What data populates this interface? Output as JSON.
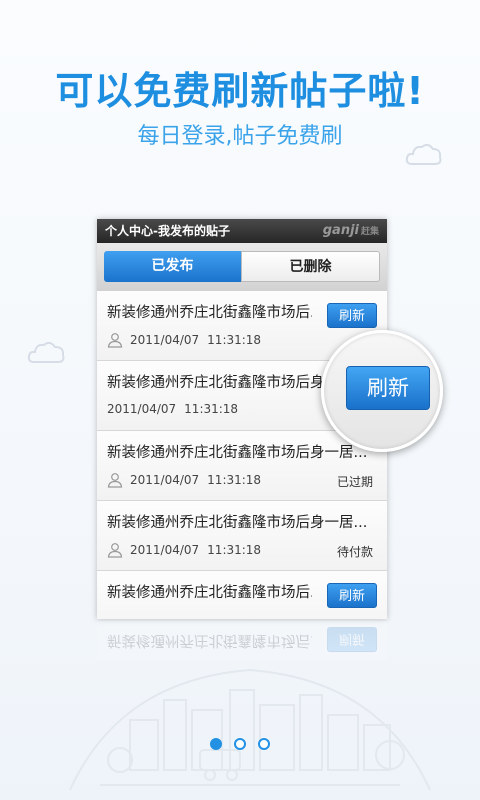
{
  "promo": {
    "headline": "可以免费刷新帖子啦!",
    "subline": "每日登录,帖子免费刷"
  },
  "screen": {
    "title": "个人中心-我发布的贴子",
    "brand": "ganji",
    "brand_sub": "赶集",
    "tabs": [
      {
        "label": "已发布",
        "active": true
      },
      {
        "label": "已删除",
        "active": false
      }
    ],
    "posts": [
      {
        "title": "新装修通州乔庄北街鑫隆市场后...",
        "date": "2011/04/07",
        "time": "11:31:18",
        "action": "刷新",
        "status": ""
      },
      {
        "title": "新装修通州乔庄北街鑫隆市场后身",
        "date": "2011/04/07",
        "time": "11:31:18",
        "action": "",
        "status": ""
      },
      {
        "title": "新装修通州乔庄北街鑫隆市场后身一居...",
        "date": "2011/04/07",
        "time": "11:31:18",
        "action": "",
        "status": "已过期"
      },
      {
        "title": "新装修通州乔庄北街鑫隆市场后身一居...",
        "date": "2011/04/07",
        "time": "11:31:18",
        "action": "",
        "status": "待付款"
      },
      {
        "title": "新装修通州乔庄北街鑫隆市场后...",
        "date": "",
        "time": "",
        "action": "刷新",
        "status": ""
      }
    ]
  },
  "magnifier": {
    "button_label": "刷新"
  },
  "pager": {
    "pages": 3,
    "current": 1
  },
  "colors": {
    "accent": "#1e8ee0",
    "button": "#1b73cc"
  }
}
